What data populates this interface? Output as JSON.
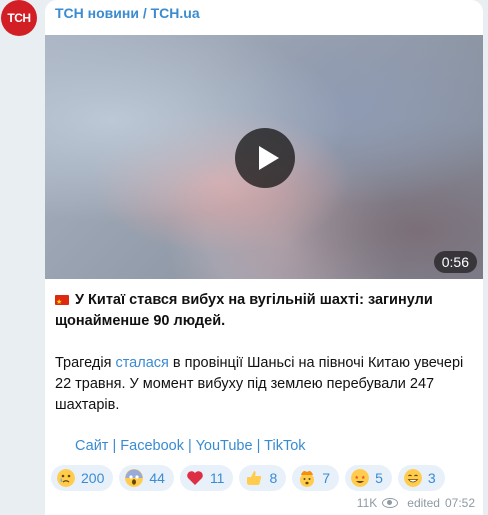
{
  "channel": {
    "name": "ТСН новини / TCH.ua",
    "avatar_text": "ТСН"
  },
  "video": {
    "duration": "0:56"
  },
  "post": {
    "headline": "У Китаї стався вибух на вугільній шахті: загинули щонайменше 90 людей.",
    "body_before_link": "Трагедія ",
    "body_link": "сталася",
    "body_after_link": " в провінції Шаньсі на півночі Китаю увечері 22 травня. У момент вибуху під землею перебували 247 шахтарів."
  },
  "links": {
    "site": "Сайт",
    "facebook": "Facebook",
    "youtube": "YouTube",
    "tiktok": "TikTok",
    "separator": "|"
  },
  "reactions": [
    {
      "icon": "crying-face-icon",
      "count": "200"
    },
    {
      "icon": "screaming-face-icon",
      "count": "44"
    },
    {
      "icon": "red-heart-icon",
      "count": "11"
    },
    {
      "icon": "thumbs-up-icon",
      "count": "8"
    },
    {
      "icon": "exploding-head-icon",
      "count": "7"
    },
    {
      "icon": "star-struck-icon",
      "count": "5"
    },
    {
      "icon": "grinning-face-icon",
      "count": "3"
    }
  ],
  "footer": {
    "views": "11K",
    "edited": "edited",
    "time": "07:52"
  },
  "colors": {
    "accent": "#3a8bd2",
    "avatar": "#d21f26",
    "background": "#e9eef2"
  }
}
